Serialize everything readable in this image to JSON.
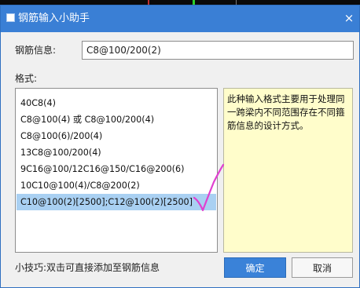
{
  "dialog": {
    "title": "钢筋输入小助手",
    "close_symbol": "×",
    "info_label": "钢筋信息:",
    "info_value": "C8@100/200(2)",
    "format_label": "格式:",
    "formats": [
      "40C8(4)",
      "C8@100(4) 或 C8@100/200(4)",
      "C8@100(6)/200(4)",
      "13C8@100/200(4)",
      "9C16@100/12C16@150/C16@200(6)",
      "10C10@100(4)/C8@200(2)",
      "C10@100(2)[2500];C12@100(2)[2500]"
    ],
    "selected_index": 6,
    "description": "此种输入格式主要用于处理同一跨梁内不同范围存在不同箍筋信息的设计方式。",
    "tip": "小技巧:双击可直接添加至钢筋信息",
    "ok_label": "确定",
    "cancel_label": "取消"
  },
  "colors": {
    "title_bar": "#3a7fd5",
    "ok_button": "#3a82d8",
    "selection": "#a9d0f2",
    "description_bg": "#fffdcb",
    "annotation": "#e040d0"
  },
  "icons": [
    "window-icon",
    "close-icon"
  ]
}
